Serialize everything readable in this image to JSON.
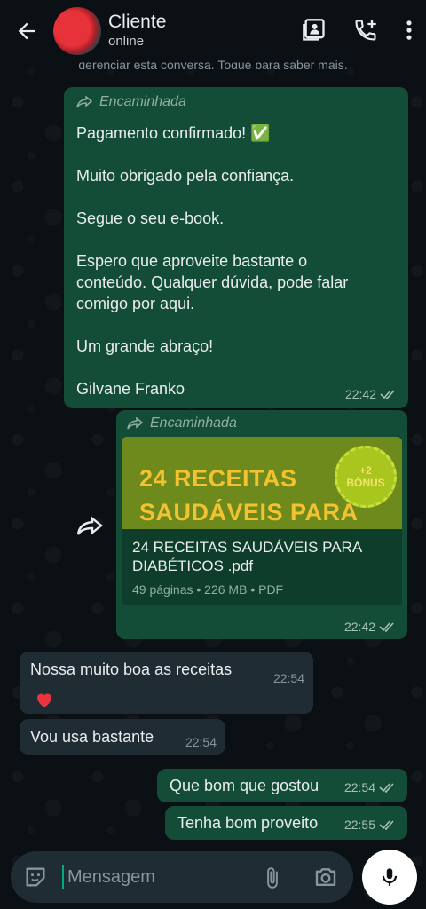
{
  "header": {
    "contact_name": "Cliente",
    "contact_status": "online"
  },
  "notice": "gerenciar esta conversa. Toque para saber mais.",
  "messages": [
    {
      "direction": "outgoing",
      "forwarded_label": "Encaminhada",
      "text": "Pagamento confirmado! ✅\n\nMuito obrigado pela confiança.\n\nSegue o seu e-book.\n\nEspero que aproveite bastante o\nconteúdo. Qualquer dúvida, pode falar\ncomigo por aqui.\n\nUm grande abraço!\n\nGilvane Franko",
      "time": "22:42"
    },
    {
      "direction": "outgoing",
      "forwarded_label": "Encaminhada",
      "thumbnail_title_line1": "24 RECEITAS",
      "thumbnail_title_line2": "SAUDÁVEIS PARA",
      "thumbnail_badge_line1": "+2",
      "thumbnail_badge_line2": "BÔNUS",
      "file_name": "24 RECEITAS SAUDÁVEIS PARA DIABÉTICOS .pdf",
      "file_meta": "49 páginas • 226 MB • PDF",
      "time": "22:42"
    },
    {
      "direction": "incoming",
      "text": "Nossa muito boa as receitas",
      "time": "22:54"
    },
    {
      "direction": "incoming",
      "text": "Vou usa bastante",
      "time": "22:54"
    },
    {
      "direction": "outgoing",
      "text": "Que bom que gostou",
      "time": "22:54"
    },
    {
      "direction": "outgoing",
      "text": "Tenha bom proveito",
      "time": "22:55"
    }
  ],
  "composer": {
    "placeholder": "Mensagem"
  },
  "colors": {
    "outgoing_bubble": "#144d37",
    "incoming_bubble": "#1f2c34",
    "background": "#0b1014",
    "accent": "#00a884"
  }
}
